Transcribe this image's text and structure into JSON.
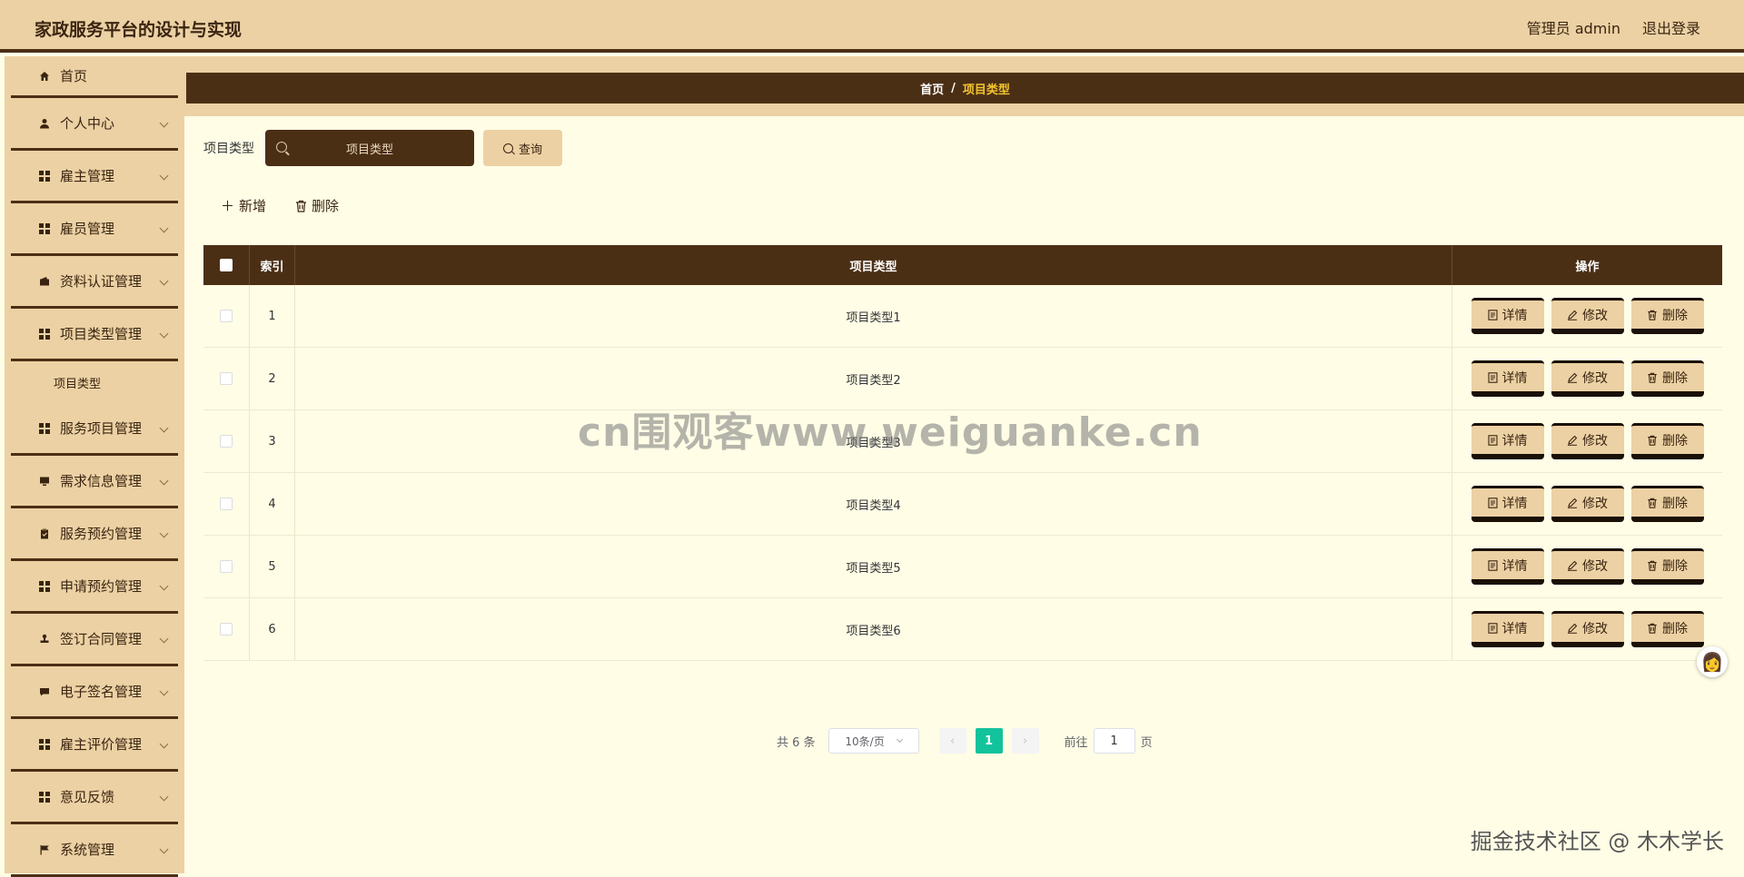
{
  "header": {
    "title": "家政服务平台的设计与实现",
    "user": "管理员 admin",
    "logout": "退出登录"
  },
  "sidebar": {
    "items": [
      {
        "label": "首页",
        "icon": "home-icon",
        "chevron": false
      },
      {
        "label": "个人中心",
        "icon": "person-icon",
        "chevron": true
      },
      {
        "label": "雇主管理",
        "icon": "grid-icon",
        "chevron": true
      },
      {
        "label": "雇员管理",
        "icon": "grid-icon",
        "chevron": true
      },
      {
        "label": "资料认证管理",
        "icon": "wallet-icon",
        "chevron": true
      },
      {
        "label": "项目类型管理",
        "icon": "grid-icon",
        "chevron": true
      },
      {
        "label": "服务项目管理",
        "icon": "grid-icon",
        "chevron": true
      },
      {
        "label": "需求信息管理",
        "icon": "monitor-icon",
        "chevron": true
      },
      {
        "label": "服务预约管理",
        "icon": "clipboard-icon",
        "chevron": true
      },
      {
        "label": "申请预约管理",
        "icon": "grid-icon",
        "chevron": true
      },
      {
        "label": "签订合同管理",
        "icon": "stamp-icon",
        "chevron": true
      },
      {
        "label": "电子签名管理",
        "icon": "chat-icon",
        "chevron": true
      },
      {
        "label": "雇主评价管理",
        "icon": "grid-icon",
        "chevron": true
      },
      {
        "label": "意见反馈",
        "icon": "grid-icon",
        "chevron": true
      },
      {
        "label": "系统管理",
        "icon": "flag-icon",
        "chevron": true
      }
    ],
    "sub_item": "项目类型"
  },
  "breadcrumb": {
    "home": "首页",
    "sep": "/",
    "current": "项目类型"
  },
  "search": {
    "label": "项目类型",
    "placeholder": "项目类型",
    "button": "查询"
  },
  "actions": {
    "add": "新增",
    "delete": "删除"
  },
  "table": {
    "headers": {
      "index": "索引",
      "type": "项目类型",
      "ops": "操作"
    },
    "rows": [
      {
        "index": "1",
        "type": "项目类型1"
      },
      {
        "index": "2",
        "type": "项目类型2"
      },
      {
        "index": "3",
        "type": "项目类型3"
      },
      {
        "index": "4",
        "type": "项目类型4"
      },
      {
        "index": "5",
        "type": "项目类型5"
      },
      {
        "index": "6",
        "type": "项目类型6"
      }
    ],
    "row_buttons": {
      "detail": "详情",
      "edit": "修改",
      "delete": "删除"
    }
  },
  "pagination": {
    "total": "共 6 条",
    "page_size": "10条/页",
    "current_page": "1",
    "goto_label": "前往",
    "goto_value": "1",
    "page_unit": "页"
  },
  "watermark": "cn围观客www.weiguanke.cn",
  "credit": "掘金技术社区 @ 木木学长",
  "colors": {
    "brown": "#4b2f15",
    "tan": "#ecd1a4",
    "bg": "#fffde6",
    "page_active": "#13c39b"
  }
}
